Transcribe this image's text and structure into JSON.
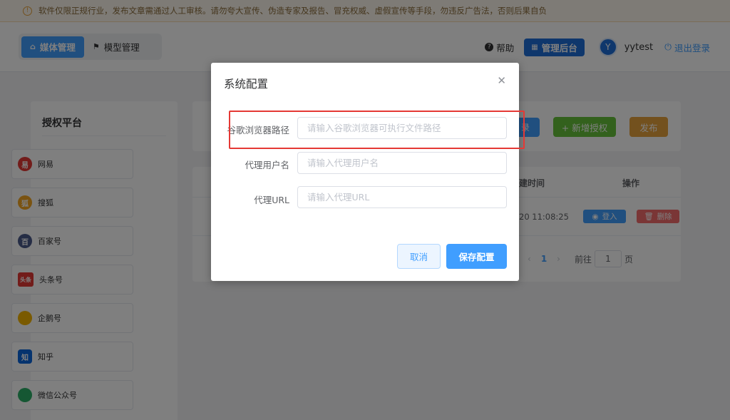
{
  "notice": {
    "text": "软件仅限正规行业，发布文章需通过人工审核。请勿夸大宣传、伪造专家及报告、冒充权威、虚假宣传等手段，勿违反广告法，否则后果自负"
  },
  "header": {
    "tabs": [
      {
        "label": "媒体管理",
        "icon": "home-icon",
        "active": true
      },
      {
        "label": "模型管理",
        "icon": "flag-icon",
        "active": false
      }
    ],
    "help_label": "帮助",
    "admin_label": "管理后台",
    "avatar_letter": "Y",
    "username": "yytest",
    "logout_label": "退出登录"
  },
  "sidebar": {
    "title": "授权平台",
    "items": [
      {
        "label": "网易",
        "icon": "netease-icon",
        "color": "#e53935",
        "glyph": "易"
      },
      {
        "label": "搜狐",
        "icon": "sohu-icon",
        "color": "#f5a623",
        "glyph": "狐"
      },
      {
        "label": "百家号",
        "icon": "baijiahao-icon",
        "color": "#4a5a8a",
        "glyph": "百"
      },
      {
        "label": "头条号",
        "icon": "toutiao-icon",
        "color": "#e53935",
        "glyph": "头条"
      },
      {
        "label": "企鹅号",
        "icon": "qiehao-icon",
        "color": "#f5b400",
        "glyph": ""
      },
      {
        "label": "知乎",
        "icon": "zhihu-icon",
        "color": "#0a66dd",
        "glyph": "知"
      },
      {
        "label": "微信公众号",
        "icon": "wechat-icon",
        "color": "#2aae67",
        "glyph": ""
      }
    ]
  },
  "toolbar": {
    "add_label": "+ 新增授权",
    "publish_label": "发布",
    "partial_label": "录"
  },
  "table": {
    "col_time": "建时间",
    "col_op": "操作",
    "row_time": "20 11:08:25",
    "login_label": "登入",
    "delete_label": "删除"
  },
  "pager": {
    "current": "1",
    "goto_prefix": "前往",
    "goto_value": "1",
    "goto_suffix": "页"
  },
  "dialog": {
    "title": "系统配置",
    "fields": [
      {
        "label": "谷歌浏览器路径",
        "placeholder": "请输入谷歌浏览器可执行文件路径"
      },
      {
        "label": "代理用户名",
        "placeholder": "请输入代理用户名"
      },
      {
        "label": "代理URL",
        "placeholder": "请输入代理URL"
      }
    ],
    "cancel_label": "取消",
    "save_label": "保存配置"
  },
  "colors": {
    "primary": "#409eff",
    "success": "#67c23a",
    "warning": "#e6a23c",
    "danger": "#f56c6c",
    "highlight": "#e53935"
  }
}
